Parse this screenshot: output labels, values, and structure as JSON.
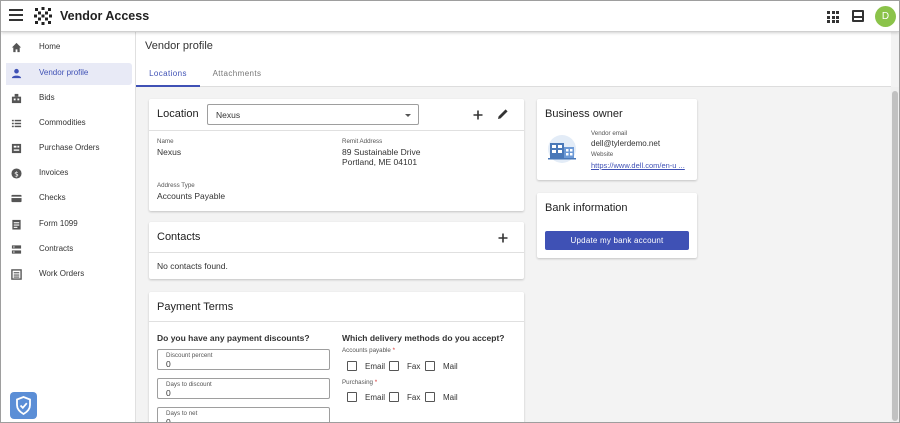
{
  "app": {
    "title": "Vendor Access",
    "avatar_initial": "D"
  },
  "colors": {
    "accent": "#3f51b5",
    "avatar": "#8bc34a",
    "active_nav": "#e8eaf6",
    "shield": "#5b8ed6",
    "required": "#d32f2f"
  },
  "sidebar": {
    "items": [
      {
        "label": "Home",
        "icon": "home-icon"
      },
      {
        "label": "Vendor profile",
        "icon": "person-icon",
        "active": true
      },
      {
        "label": "Bids",
        "icon": "bids-icon"
      },
      {
        "label": "Commodities",
        "icon": "list-icon"
      },
      {
        "label": "Purchase Orders",
        "icon": "purchase-orders-icon"
      },
      {
        "label": "Invoices",
        "icon": "dollar-icon"
      },
      {
        "label": "Checks",
        "icon": "check-card-icon"
      },
      {
        "label": "Form 1099",
        "icon": "form-icon"
      },
      {
        "label": "Contracts",
        "icon": "contracts-icon"
      },
      {
        "label": "Work Orders",
        "icon": "work-orders-icon"
      }
    ]
  },
  "page": {
    "title": "Vendor profile",
    "tabs": [
      {
        "label": "Locations",
        "active": true
      },
      {
        "label": "Attachments"
      }
    ]
  },
  "location": {
    "title": "Location",
    "selected": "Nexus",
    "name_label": "Name",
    "name": "Nexus",
    "remit_label": "Remit Address",
    "remit_line1": "89 Sustainable Drive",
    "remit_line2": "Portland, ME 04101",
    "type_label": "Address Type",
    "type": "Accounts Payable"
  },
  "contacts": {
    "title": "Contacts",
    "empty": "No contacts found."
  },
  "payment": {
    "title": "Payment Terms",
    "discount_question": "Do you have any payment discounts?",
    "fields": [
      {
        "label": "Discount percent",
        "value": "0"
      },
      {
        "label": "Days to discount",
        "value": "0"
      },
      {
        "label": "Days to net",
        "value": "0"
      }
    ],
    "delivery_question": "Which delivery methods do you accept?",
    "ap_label": "Accounts payable",
    "purchasing_label": "Purchasing",
    "required_mark": "*",
    "methods": [
      "Email",
      "Fax",
      "Mail"
    ]
  },
  "business_owner": {
    "title": "Business owner",
    "email_label": "Vendor email",
    "email": "dell@tylerdemo.net",
    "website_label": "Website",
    "website": "https://www.dell.com/en-u ..."
  },
  "bank": {
    "title": "Bank information",
    "button": "Update my bank account"
  }
}
